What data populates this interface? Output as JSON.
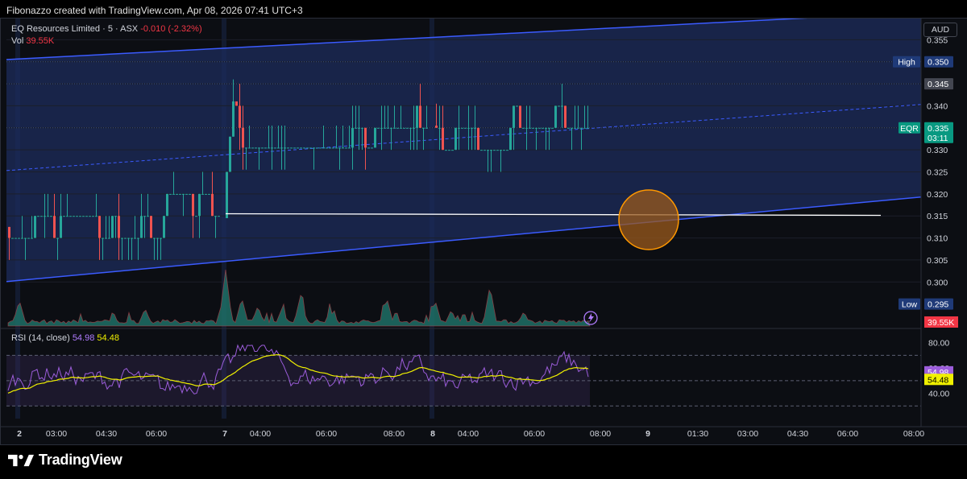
{
  "headline": "Fibonazzo created with TradingView.com, Apr 08, 2026 07:41 UTC+3",
  "legend": {
    "symbol": "EQ Resources Limited · 5 · ASX",
    "change": "-0.010 (-2.32%)",
    "vol_label": "Vol",
    "vol_value": "39.55K",
    "rsi_label": "RSI (14, close)",
    "rsi_value": "54.98",
    "rsi_ma_value": "54.48"
  },
  "currency": "AUD",
  "branding": "TradingView",
  "chart_data": [
    {
      "type": "candlestick",
      "symbol": "EQR",
      "ylim": [
        0.29,
        0.36
      ],
      "y_ticks": [
        0.3,
        0.305,
        0.31,
        0.315,
        0.32,
        0.325,
        0.33,
        0.335,
        0.34,
        0.345,
        0.35,
        0.355
      ],
      "y_tick_labels": [
        "0.300",
        "0.305",
        "0.310",
        "0.315",
        "0.320",
        "0.325",
        "0.330",
        "0.335",
        "0.340",
        "0.345",
        "0.350",
        "0.355"
      ],
      "x_tick_labels": [
        "2",
        "03:00",
        "04:30",
        "06:00",
        "7",
        "04:00",
        "06:00",
        "08:00",
        "8",
        "04:00",
        "06:00",
        "08:00",
        "9",
        "01:30",
        "03:00",
        "04:30",
        "06:00",
        "08:00"
      ],
      "price_tags": [
        {
          "label": "High",
          "value": "0.350",
          "price": 0.35,
          "color": "#1f3a78"
        },
        {
          "label": "",
          "value": "0.345",
          "price": 0.345,
          "color": "#434651"
        },
        {
          "label": "EQR",
          "value": "0.335",
          "extra": "03:11",
          "price": 0.335,
          "color": "#089981"
        },
        {
          "label": "Low",
          "value": "0.295",
          "price": 0.295,
          "color": "#1f3a78"
        }
      ],
      "volume_tag": "39.55K",
      "channel": {
        "upper": [
          [
            0,
            0.3505
          ],
          [
            1,
            0.3613
          ]
        ],
        "middle": [
          [
            0,
            0.3253
          ],
          [
            1,
            0.3403
          ]
        ],
        "lower": [
          [
            0,
            0.3001
          ],
          [
            1,
            0.3193
          ]
        ]
      },
      "horizontal_line": 0.3155,
      "marker_circle": 0.3145,
      "segments": [
        {
          "start": 0.3125,
          "end": 0.3145,
          "low": 0.3045,
          "high": 0.3205
        },
        {
          "start": 0.3145,
          "end": 0.3355,
          "low": 0.3305,
          "high": 0.3505
        },
        {
          "start": 0.3355,
          "end": 0.3345,
          "low": 0.3285,
          "high": 0.3505
        }
      ]
    },
    {
      "type": "line",
      "name": "RSI",
      "ylim": [
        20,
        90
      ],
      "y_tick_labels": [
        "80.00",
        "60.00",
        "40.00"
      ],
      "y_ticks": [
        80,
        60,
        40
      ],
      "bands": [
        30,
        50,
        70
      ],
      "tags": [
        {
          "value": "54.98",
          "color": "#9c5ddb",
          "level": 57
        },
        {
          "value": "54.48",
          "color": "#f0f000",
          "level": 51
        }
      ]
    }
  ]
}
